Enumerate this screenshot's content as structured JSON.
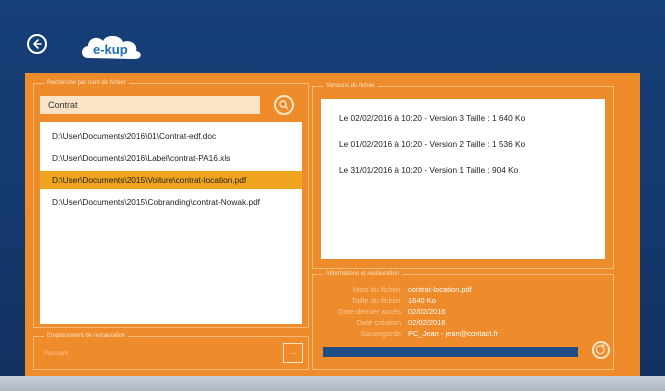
{
  "app": {
    "logo_text": "e-kup"
  },
  "search": {
    "title": "Recherche par nom de fichier",
    "value": "Contrat"
  },
  "files": [
    "D:\\User\\Documents\\2016\\01\\Contrat-edf.doc",
    "D:\\User\\Documents\\2016\\Label\\contrat-PA16.xls",
    "D:\\User\\Documents\\2015\\Voiture\\contrat-location.pdf",
    "D:\\User\\Documents\\2015\\Cobranding\\contrat-Nowak.pdf"
  ],
  "selected_file_index": 2,
  "versions": {
    "title": "Versions du fichier",
    "items": [
      "Le 02/02/2016 à 10:20 - Version 3 Taille : 1 640 Ko",
      "Le 01/02/2016 à 10:20 - Version 2 Taille : 1 536 Ko",
      "Le 31/01/2016 à 10:20 - Version 1 Taille : 904 Ko"
    ]
  },
  "info": {
    "title": "Informations et restauration",
    "rows": [
      {
        "label": "Nom du fichier",
        "value": "contrat-location.pdf"
      },
      {
        "label": "Taille du fichier",
        "value": "1640 Ko"
      },
      {
        "label": "Date dernier accès",
        "value": "02/02/2016"
      },
      {
        "label": "Date création",
        "value": "02/02/2016"
      },
      {
        "label": "Sauvegarde",
        "value": "PC_Jean - jean@contact.fr"
      }
    ]
  },
  "destination": {
    "title": "Emplacement de restauration",
    "value": "Parcourir",
    "browse_label": "..."
  },
  "colors": {
    "background": "#173f78",
    "panel": "#ee8b2b",
    "selected": "#f0a31e",
    "progress": "#1e4f84"
  }
}
